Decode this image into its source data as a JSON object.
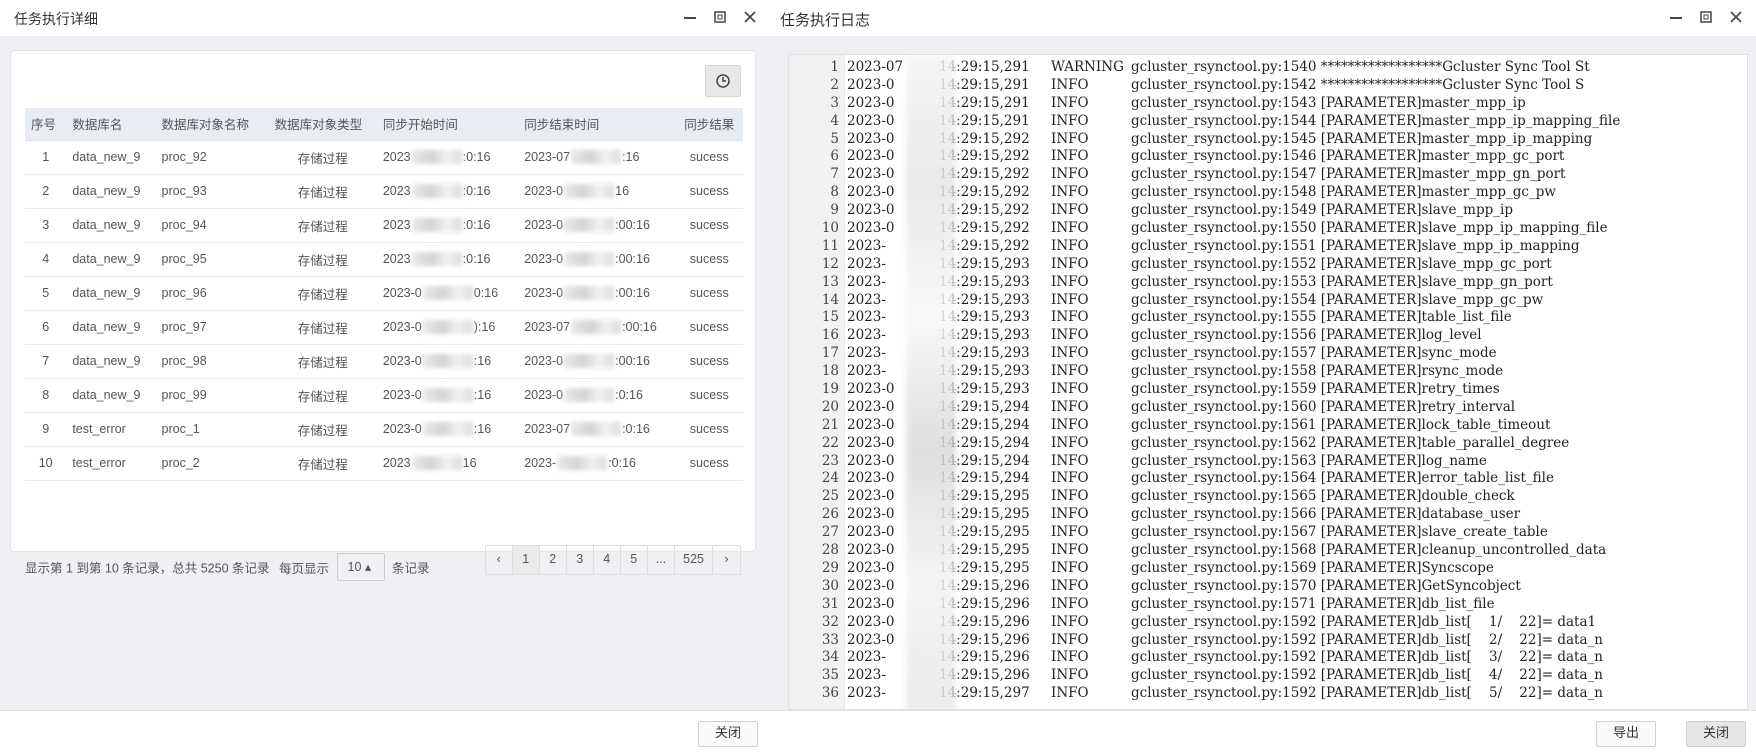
{
  "left": {
    "title": "任务执行详细",
    "columns": [
      "序号",
      "数据库名",
      "数据库对象名称",
      "数据库对象类型",
      "同步开始时间",
      "同步结束时间",
      "同步结果"
    ],
    "rows": [
      {
        "no": "1",
        "db": "data_new_9",
        "obj": "proc_92",
        "type": "存储过程",
        "start_a": "2023",
        "start_b": ":0:16",
        "end_a": "2023-07",
        "end_b": ":16",
        "result": "sucess"
      },
      {
        "no": "2",
        "db": "data_new_9",
        "obj": "proc_93",
        "type": "存储过程",
        "start_a": "2023",
        "start_b": ":0:16",
        "end_a": "2023-0",
        "end_b": "16",
        "result": "sucess"
      },
      {
        "no": "3",
        "db": "data_new_9",
        "obj": "proc_94",
        "type": "存储过程",
        "start_a": "2023",
        "start_b": ":0:16",
        "end_a": "2023-0",
        "end_b": ":00:16",
        "result": "sucess"
      },
      {
        "no": "4",
        "db": "data_new_9",
        "obj": "proc_95",
        "type": "存储过程",
        "start_a": "2023",
        "start_b": ":0:16",
        "end_a": "2023-0",
        "end_b": ":00:16",
        "result": "sucess"
      },
      {
        "no": "5",
        "db": "data_new_9",
        "obj": "proc_96",
        "type": "存储过程",
        "start_a": "2023-0",
        "start_b": "0:16",
        "end_a": "2023-0",
        "end_b": ":00:16",
        "result": "sucess"
      },
      {
        "no": "6",
        "db": "data_new_9",
        "obj": "proc_97",
        "type": "存储过程",
        "start_a": "2023-0",
        "start_b": "):16",
        "end_a": "2023-07",
        "end_b": ":00:16",
        "result": "sucess"
      },
      {
        "no": "7",
        "db": "data_new_9",
        "obj": "proc_98",
        "type": "存储过程",
        "start_a": "2023-0",
        "start_b": ":16",
        "end_a": "2023-0",
        "end_b": ":00:16",
        "result": "sucess"
      },
      {
        "no": "8",
        "db": "data_new_9",
        "obj": "proc_99",
        "type": "存储过程",
        "start_a": "2023-0",
        "start_b": ":16",
        "end_a": "2023-0",
        "end_b": ":0:16",
        "result": "sucess"
      },
      {
        "no": "9",
        "db": "test_error",
        "obj": "proc_1",
        "type": "存储过程",
        "start_a": "2023-0",
        "start_b": ":16",
        "end_a": "2023-07",
        "end_b": ":0:16",
        "result": "sucess"
      },
      {
        "no": "10",
        "db": "test_error",
        "obj": "proc_2",
        "type": "存储过程",
        "start_a": "2023",
        "start_b": "16",
        "end_a": "2023-",
        "end_b": ":0:16",
        "result": "sucess"
      }
    ],
    "pager": {
      "info": "显示第 1 到第 10 条记录，总共 5250 条记录",
      "per_page_label": "每页显示",
      "per_page_value": "10 ▴",
      "per_page_suffix": "条记录",
      "pages": [
        "‹",
        "1",
        "2",
        "3",
        "4",
        "5",
        "...",
        "525",
        "›"
      ],
      "active": "1"
    },
    "close_label": "关闭"
  },
  "right": {
    "title": "任务执行日志",
    "lines": [
      {
        "n": "1",
        "d": "2023-07",
        "tm": "14:29:15,291",
        "lv": "WARNING",
        "msg": "gcluster_rsynctool.py:1540 ******************Gcluster Sync Tool St"
      },
      {
        "n": "2",
        "d": "2023-0",
        "tm": "14:29:15,291",
        "lv": "INFO",
        "msg": "gcluster_rsynctool.py:1542 ******************Gcluster Sync Tool S"
      },
      {
        "n": "3",
        "d": "2023-0",
        "tm": "14:29:15,291",
        "lv": "INFO",
        "msg": "gcluster_rsynctool.py:1543 [PARAMETER]master_mpp_ip"
      },
      {
        "n": "4",
        "d": "2023-0",
        "tm": "14:29:15,291",
        "lv": "INFO",
        "msg": "gcluster_rsynctool.py:1544 [PARAMETER]master_mpp_ip_mapping_file"
      },
      {
        "n": "5",
        "d": "2023-0",
        "tm": "14:29:15,292",
        "lv": "INFO",
        "msg": "gcluster_rsynctool.py:1545 [PARAMETER]master_mpp_ip_mapping"
      },
      {
        "n": "6",
        "d": "2023-0",
        "tm": "14:29:15,292",
        "lv": "INFO",
        "msg": "gcluster_rsynctool.py:1546 [PARAMETER]master_mpp_gc_port"
      },
      {
        "n": "7",
        "d": "2023-0",
        "tm": "14:29:15,292",
        "lv": "INFO",
        "msg": "gcluster_rsynctool.py:1547 [PARAMETER]master_mpp_gn_port"
      },
      {
        "n": "8",
        "d": "2023-0",
        "tm": "14:29:15,292",
        "lv": "INFO",
        "msg": "gcluster_rsynctool.py:1548 [PARAMETER]master_mpp_gc_pw"
      },
      {
        "n": "9",
        "d": "2023-0",
        "tm": "14:29:15,292",
        "lv": "INFO",
        "msg": "gcluster_rsynctool.py:1549 [PARAMETER]slave_mpp_ip"
      },
      {
        "n": "10",
        "d": "2023-0",
        "tm": "14:29:15,292",
        "lv": "INFO",
        "msg": "gcluster_rsynctool.py:1550 [PARAMETER]slave_mpp_ip_mapping_file"
      },
      {
        "n": "11",
        "d": "2023-",
        "tm": "14:29:15,292",
        "lv": "INFO",
        "msg": "gcluster_rsynctool.py:1551 [PARAMETER]slave_mpp_ip_mapping"
      },
      {
        "n": "12",
        "d": "2023-",
        "tm": "14:29:15,293",
        "lv": "INFO",
        "msg": "gcluster_rsynctool.py:1552 [PARAMETER]slave_mpp_gc_port"
      },
      {
        "n": "13",
        "d": "2023-",
        "tm": "14:29:15,293",
        "lv": "INFO",
        "msg": "gcluster_rsynctool.py:1553 [PARAMETER]slave_mpp_gn_port"
      },
      {
        "n": "14",
        "d": "2023-",
        "tm": "14:29:15,293",
        "lv": "INFO",
        "msg": "gcluster_rsynctool.py:1554 [PARAMETER]slave_mpp_gc_pw"
      },
      {
        "n": "15",
        "d": "2023-",
        "tm": "14:29:15,293",
        "lv": "INFO",
        "msg": "gcluster_rsynctool.py:1555 [PARAMETER]table_list_file"
      },
      {
        "n": "16",
        "d": "2023-",
        "tm": "14:29:15,293",
        "lv": "INFO",
        "msg": "gcluster_rsynctool.py:1556 [PARAMETER]log_level"
      },
      {
        "n": "17",
        "d": "2023-",
        "tm": "14:29:15,293",
        "lv": "INFO",
        "msg": "gcluster_rsynctool.py:1557 [PARAMETER]sync_mode"
      },
      {
        "n": "18",
        "d": "2023-",
        "tm": "14:29:15,293",
        "lv": "INFO",
        "msg": "gcluster_rsynctool.py:1558 [PARAMETER]rsync_mode"
      },
      {
        "n": "19",
        "d": "2023-0",
        "tm": "14:29:15,293",
        "lv": "INFO",
        "msg": "gcluster_rsynctool.py:1559 [PARAMETER]retry_times"
      },
      {
        "n": "20",
        "d": "2023-0",
        "tm": "14:29:15,294",
        "lv": "INFO",
        "msg": "gcluster_rsynctool.py:1560 [PARAMETER]retry_interval"
      },
      {
        "n": "21",
        "d": "2023-0",
        "tm": "14:29:15,294",
        "lv": "INFO",
        "msg": "gcluster_rsynctool.py:1561 [PARAMETER]lock_table_timeout"
      },
      {
        "n": "22",
        "d": "2023-0",
        "tm": "14:29:15,294",
        "lv": "INFO",
        "msg": "gcluster_rsynctool.py:1562 [PARAMETER]table_parallel_degree"
      },
      {
        "n": "23",
        "d": "2023-0",
        "tm": "14:29:15,294",
        "lv": "INFO",
        "msg": "gcluster_rsynctool.py:1563 [PARAMETER]log_name"
      },
      {
        "n": "24",
        "d": "2023-0",
        "tm": "14:29:15,294",
        "lv": "INFO",
        "msg": "gcluster_rsynctool.py:1564 [PARAMETER]error_table_list_file"
      },
      {
        "n": "25",
        "d": "2023-0",
        "tm": "14:29:15,295",
        "lv": "INFO",
        "msg": "gcluster_rsynctool.py:1565 [PARAMETER]double_check"
      },
      {
        "n": "26",
        "d": "2023-0",
        "tm": "14:29:15,295",
        "lv": "INFO",
        "msg": "gcluster_rsynctool.py:1566 [PARAMETER]database_user"
      },
      {
        "n": "27",
        "d": "2023-0",
        "tm": "14:29:15,295",
        "lv": "INFO",
        "msg": "gcluster_rsynctool.py:1567 [PARAMETER]slave_create_table"
      },
      {
        "n": "28",
        "d": "2023-0",
        "tm": "14:29:15,295",
        "lv": "INFO",
        "msg": "gcluster_rsynctool.py:1568 [PARAMETER]cleanup_uncontrolled_data"
      },
      {
        "n": "29",
        "d": "2023-0",
        "tm": "14:29:15,295",
        "lv": "INFO",
        "msg": "gcluster_rsynctool.py:1569 [PARAMETER]Syncscope"
      },
      {
        "n": "30",
        "d": "2023-0",
        "tm": "14:29:15,296",
        "lv": "INFO",
        "msg": "gcluster_rsynctool.py:1570 [PARAMETER]GetSyncobject"
      },
      {
        "n": "31",
        "d": "2023-0",
        "tm": "14:29:15,296",
        "lv": "INFO",
        "msg": "gcluster_rsynctool.py:1571 [PARAMETER]db_list_file"
      },
      {
        "n": "32",
        "d": "2023-0",
        "tm": "14:29:15,296",
        "lv": "INFO",
        "msg": "gcluster_rsynctool.py:1592 [PARAMETER]db_list[    1/    22]= data1"
      },
      {
        "n": "33",
        "d": "2023-0",
        "tm": "14:29:15,296",
        "lv": "INFO",
        "msg": "gcluster_rsynctool.py:1592 [PARAMETER]db_list[    2/    22]= data_n"
      },
      {
        "n": "34",
        "d": "2023-",
        "tm": "14:29:15,296",
        "lv": "INFO",
        "msg": "gcluster_rsynctool.py:1592 [PARAMETER]db_list[    3/    22]= data_n"
      },
      {
        "n": "35",
        "d": "2023-",
        "tm": "14:29:15,296",
        "lv": "INFO",
        "msg": "gcluster_rsynctool.py:1592 [PARAMETER]db_list[    4/    22]= data_n"
      },
      {
        "n": "36",
        "d": "2023-",
        "tm": "14:29:15,297",
        "lv": "INFO",
        "msg": "gcluster_rsynctool.py:1592 [PARAMETER]db_list[    5/    22]= data_n"
      }
    ],
    "export_label": "导出",
    "close_label": "关闭"
  }
}
